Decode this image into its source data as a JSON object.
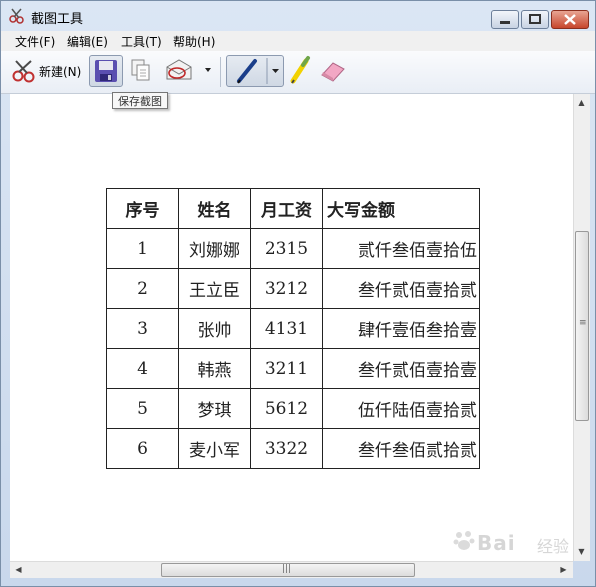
{
  "window": {
    "title": "截图工具",
    "minimize_label": "",
    "maximize_label": "",
    "close_label": ""
  },
  "menu": [
    "文件(F)",
    "编辑(E)",
    "工具(T)",
    "帮助(H)"
  ],
  "toolbar": {
    "new_label": "新建(N)",
    "tooltip": "保存截图"
  },
  "table": {
    "headers": [
      "序号",
      "姓名",
      "月工资",
      "大写金额"
    ],
    "rows": [
      [
        "1",
        "刘娜娜",
        "2315",
        "贰仟叁佰壹拾伍"
      ],
      [
        "2",
        "王立臣",
        "3212",
        "叁仟贰佰壹拾贰"
      ],
      [
        "3",
        "张帅",
        "4131",
        "肆仟壹佰叁拾壹"
      ],
      [
        "4",
        "韩燕",
        "3211",
        "叁仟贰佰壹拾壹"
      ],
      [
        "5",
        "梦琪",
        "5612",
        "伍仟陆佰壹拾贰"
      ],
      [
        "6",
        "麦小军",
        "3322",
        "叁仟叁佰贰拾贰"
      ]
    ]
  },
  "watermark": {
    "brand": "Bai",
    "suffix": "经验"
  },
  "colors": {
    "title_bg": "#c9d8ec",
    "close_red": "#c7462c",
    "annotation_arrow": "#d31a1a"
  },
  "icons": [
    "scissors-icon",
    "save-icon",
    "copy-icon",
    "send-icon",
    "pen-icon",
    "highlighter-icon",
    "eraser-icon"
  ]
}
